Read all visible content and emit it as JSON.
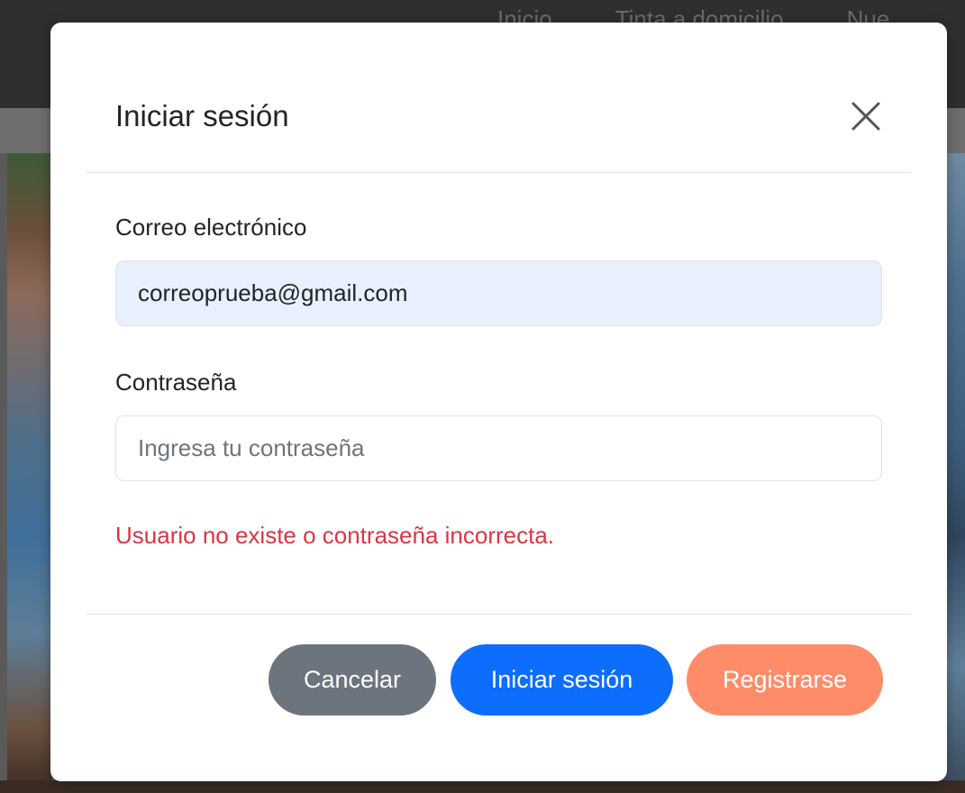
{
  "background": {
    "nav_links": [
      "Inicio",
      "Tinta a domicilio",
      "Nue"
    ]
  },
  "modal": {
    "title": "Iniciar sesión",
    "close_icon": "close-icon",
    "email": {
      "label": "Correo electrónico",
      "value": "correoprueba@gmail.com",
      "placeholder": ""
    },
    "password": {
      "label": "Contraseña",
      "value": "",
      "placeholder": "Ingresa tu contraseña"
    },
    "error": "Usuario no existe o contraseña incorrecta.",
    "buttons": {
      "cancel": "Cancelar",
      "login": "Iniciar sesión",
      "register": "Registrarse"
    }
  },
  "colors": {
    "primary": "#0d6efd",
    "secondary": "#6c757d",
    "register": "#ff8c69",
    "error": "#dc3545",
    "autofill": "#e8f0fe"
  }
}
